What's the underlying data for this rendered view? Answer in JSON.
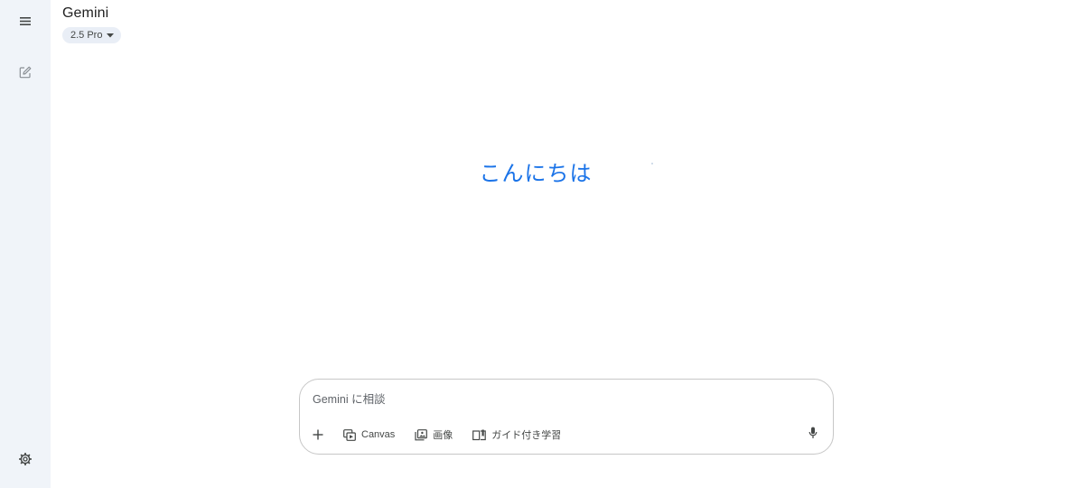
{
  "header": {
    "title": "Gemini",
    "model": "2.5 Pro"
  },
  "sidebar": {
    "icons": [
      "menu-icon",
      "new-chat-icon",
      "settings-icon"
    ]
  },
  "main": {
    "greeting": "こんにちは"
  },
  "composer": {
    "placeholder": "Gemini に相談",
    "value": "",
    "tools": [
      {
        "label": "Canvas",
        "icon": "canvas-icon"
      },
      {
        "label": "画像",
        "icon": "image-icon"
      },
      {
        "label": "ガイド付き学習",
        "icon": "guided-learning-icon"
      }
    ]
  },
  "colors": {
    "sidebar_bg": "#f0f4f9",
    "greeting": "#1a73e8",
    "chip_bg": "#e9eef6",
    "composer_border": "#c7c7c7"
  }
}
